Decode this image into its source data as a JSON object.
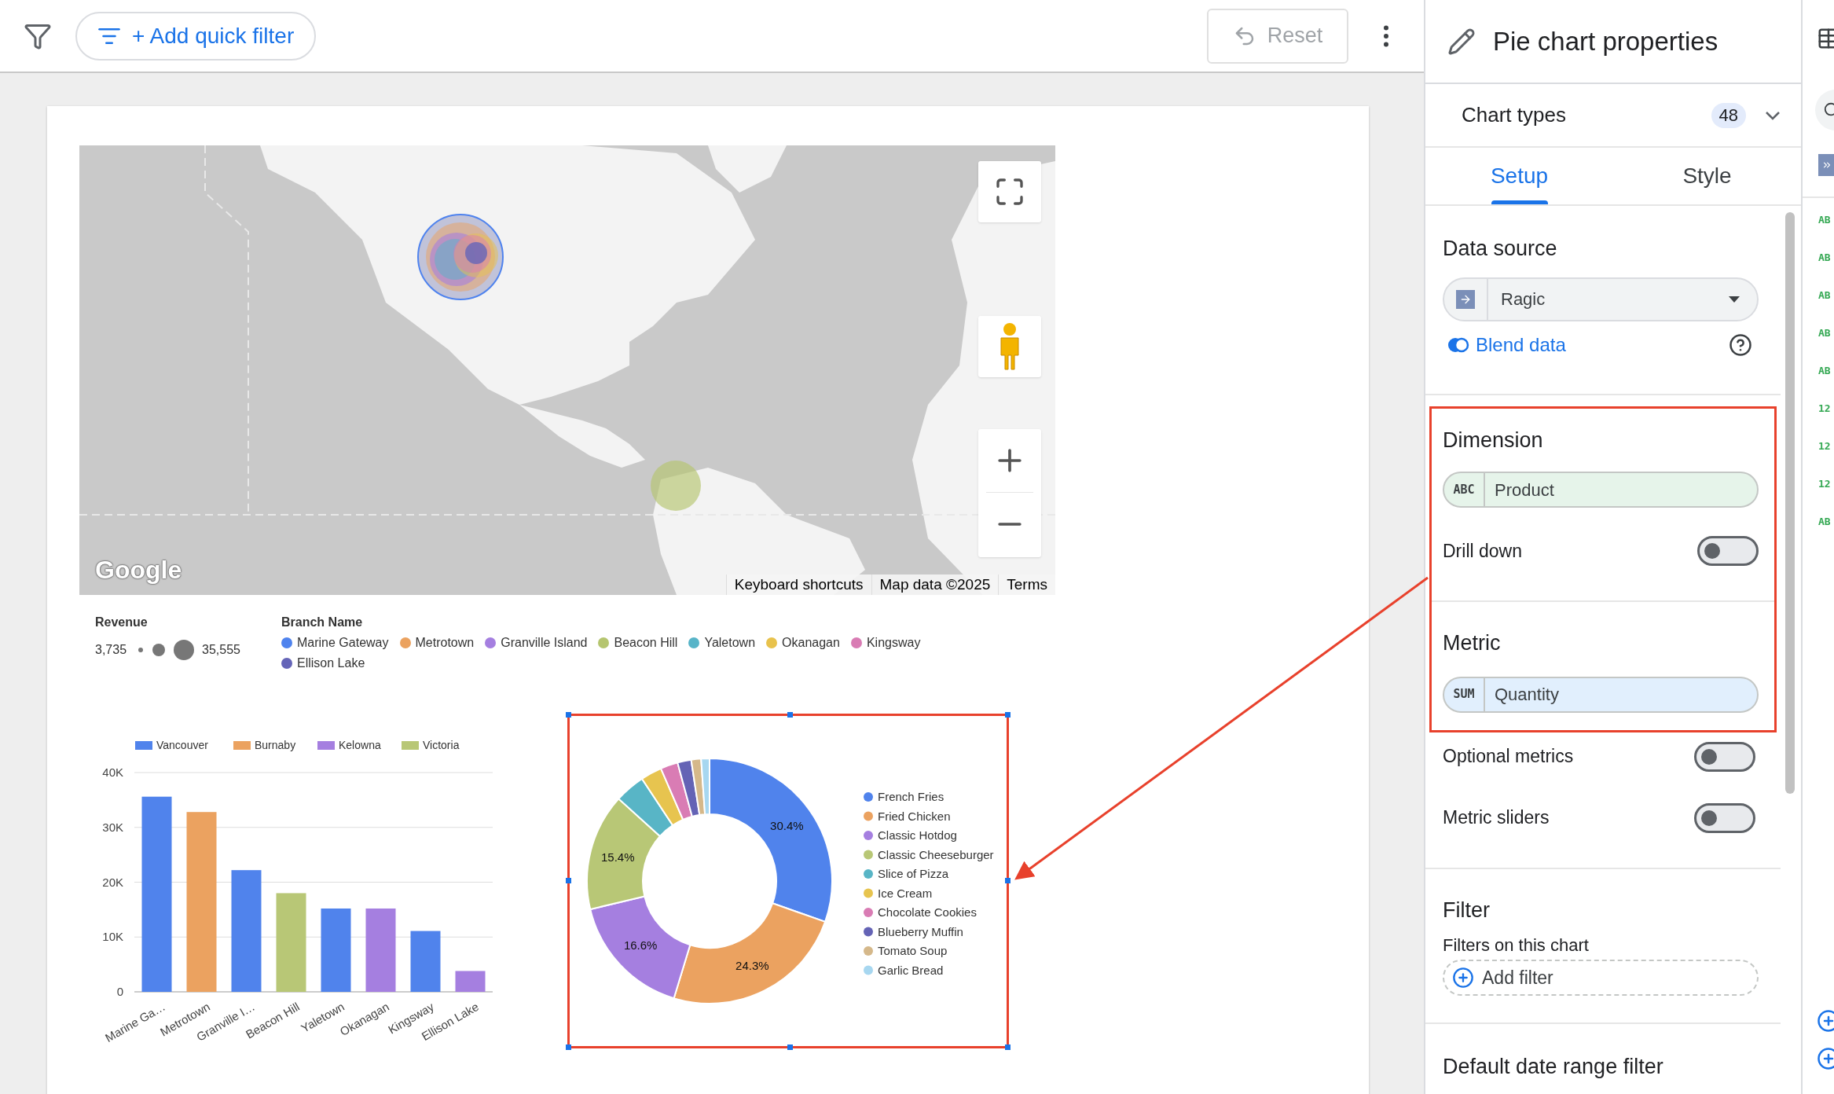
{
  "toolbar": {
    "quick_filter_button": "+ Add quick filter",
    "reset_button": {
      "label": "Reset",
      "disabled": true
    }
  },
  "map": {
    "logo": "Google",
    "attribution": [
      "Keyboard shortcuts",
      "Map data ©2025",
      "Terms"
    ]
  },
  "size_legend": {
    "title": "Revenue",
    "min": "3,735",
    "max": "35,555"
  },
  "color_legend": {
    "title": "Branch Name",
    "items": [
      {
        "label": "Marine Gateway",
        "color": "#4f83ee"
      },
      {
        "label": "Metrotown",
        "color": "#eba25f"
      },
      {
        "label": "Granville Island",
        "color": "#a57fe0"
      },
      {
        "label": "Beacon Hill",
        "color": "#b5c56f"
      },
      {
        "label": "Yaletown",
        "color": "#57b4c8"
      },
      {
        "label": "Okanagan",
        "color": "#e8c24c"
      },
      {
        "label": "Kingsway",
        "color": "#d97cb4"
      },
      {
        "label": "Ellison Lake",
        "color": "#6565b8"
      }
    ]
  },
  "bar_chart": {
    "chart_data": {
      "type": "bar",
      "grid": true,
      "legend": true,
      "categories": [
        "Marine Ga…",
        "Metrotown",
        "Granville I…",
        "Beacon Hill",
        "Yaletown",
        "Okanagan",
        "Kingsway",
        "Ellison Lake"
      ],
      "stacked": true,
      "ylim": [
        0,
        40000
      ],
      "yticks": [
        {
          "value": 0,
          "label": "0"
        },
        {
          "value": 10000,
          "label": "10K"
        },
        {
          "value": 20000,
          "label": "20K"
        },
        {
          "value": 30000,
          "label": "30K"
        },
        {
          "value": 40000,
          "label": "40K"
        }
      ],
      "series": [
        {
          "name": "Vancouver",
          "color": "#5083ec",
          "values": [
            35600,
            null,
            22200,
            null,
            15200,
            null,
            11100,
            null
          ]
        },
        {
          "name": "Burnaby",
          "color": "#eba260",
          "values": [
            null,
            32800,
            null,
            null,
            null,
            null,
            null,
            null
          ]
        },
        {
          "name": "Kelowna",
          "color": "#a57fe0",
          "values": [
            null,
            null,
            null,
            null,
            null,
            15200,
            null,
            3800
          ]
        },
        {
          "name": "Victoria",
          "color": "#b8c776",
          "values": [
            null,
            null,
            null,
            18000,
            null,
            null,
            null,
            null
          ]
        }
      ]
    }
  },
  "pie_chart": {
    "selected": true,
    "chart_data": {
      "type": "donut",
      "legend": true,
      "categories": [
        "French Fries",
        "Fried Chicken",
        "Classic Hotdog",
        "Classic Cheeseburger",
        "Slice of Pizza",
        "Ice Cream",
        "Chocolate Cookies",
        "Blueberry Muffin",
        "Tomato Soup",
        "Garlic Bread"
      ],
      "values": [
        30.4,
        24.3,
        16.6,
        15.4,
        4.0,
        2.8,
        2.3,
        1.8,
        1.3,
        1.1
      ],
      "colors": [
        "#5083ec",
        "#eba260",
        "#a57fe0",
        "#b8c776",
        "#58b5c6",
        "#e7c44f",
        "#d97cb4",
        "#6463b5",
        "#d5b88a",
        "#a7d7f0"
      ],
      "value_labels": [
        "30.4%",
        "24.3%",
        "16.6%",
        "15.4%",
        null,
        null,
        null,
        null,
        null,
        null
      ]
    }
  },
  "properties_panel": {
    "title": "Pie chart properties",
    "highlight_box": true,
    "chart_types": {
      "label": "Chart types",
      "count": "48"
    },
    "tabs": [
      {
        "label": "Setup",
        "selected": true
      },
      {
        "label": "Style",
        "selected": false
      }
    ],
    "data_source": {
      "heading": "Data source",
      "value": "Ragic",
      "blend_link": "Blend data"
    },
    "dimension": {
      "heading": "Dimension",
      "type": "ABC",
      "field": "Product",
      "drill_down": {
        "label": "Drill down",
        "on": false
      }
    },
    "metric": {
      "heading": "Metric",
      "type": "SUM",
      "field": "Quantity"
    },
    "toggles": [
      {
        "label": "Optional metrics",
        "on": false
      },
      {
        "label": "Metric sliders",
        "on": false
      }
    ],
    "filter": {
      "heading": "Filter",
      "subheading": "Filters on this chart",
      "add_button": "Add filter"
    },
    "date_range": {
      "heading": "Default date range filter"
    }
  },
  "field_strip": {
    "types": [
      "AB",
      "AB",
      "AB",
      "AB",
      "AB",
      "12",
      "12",
      "12",
      "AB"
    ]
  }
}
